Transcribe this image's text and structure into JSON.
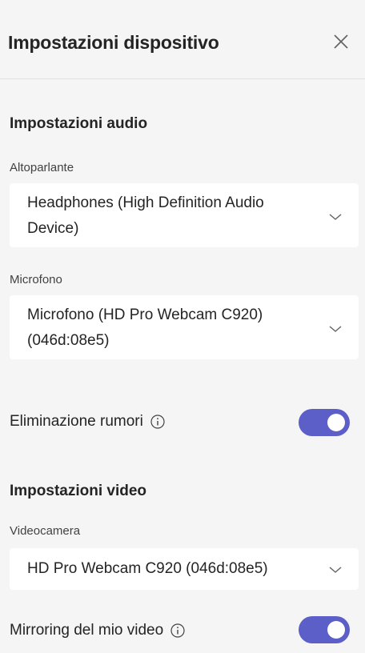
{
  "header": {
    "title": "Impostazioni dispositivo",
    "close_icon": "close-icon"
  },
  "audio": {
    "section_title": "Impostazioni audio",
    "speaker": {
      "label": "Altoparlante",
      "value_line1": "Headphones (High Definition Audio",
      "value_line2": "Device)"
    },
    "microphone": {
      "label": "Microfono",
      "value_line1": "Microfono (HD Pro Webcam C920)",
      "value_line2": "(046d:08e5)"
    },
    "noise_suppression": {
      "label": "Eliminazione rumori",
      "enabled": true
    }
  },
  "video": {
    "section_title": "Impostazioni video",
    "camera": {
      "label": "Videocamera",
      "value": "HD Pro Webcam C920 (046d:08e5)"
    },
    "mirror": {
      "label": "Mirroring del mio video",
      "enabled": true
    }
  },
  "colors": {
    "toggle_on": "#5b5fc7",
    "background": "#f5f5f5",
    "dropdown_bg": "#ffffff"
  }
}
